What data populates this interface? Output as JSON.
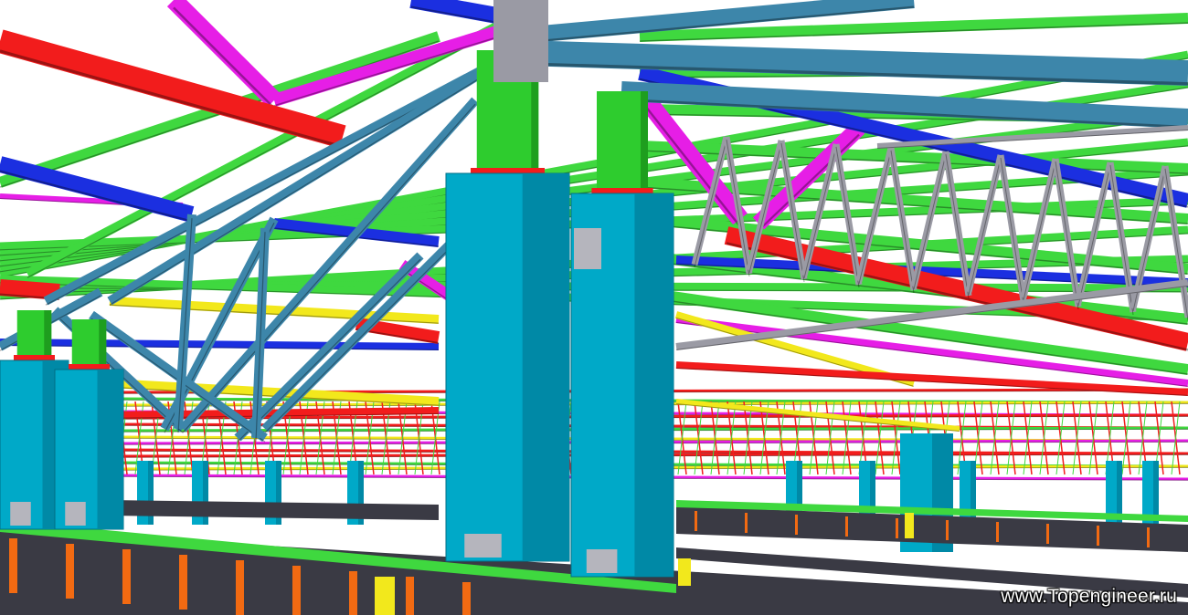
{
  "watermark": {
    "text": "www.Topengineer.ru"
  },
  "palette": {
    "background": "#ffffff",
    "column": "#00a9c8",
    "column_shade": "#0089a6",
    "column_cap": "#2ecc2e",
    "beam_red": "#f21c1c",
    "beam_blue": "#1b2fe0",
    "beam_green": "#3fd83f",
    "beam_magenta": "#e61ee6",
    "beam_yellow": "#f2e81c",
    "truss_steel": "#3d86aa",
    "truss_grey": "#9a9aa4",
    "floor_beam": "#3a3a44",
    "floor_stripe": "#f26a12",
    "plate": "#b5b5bd"
  }
}
